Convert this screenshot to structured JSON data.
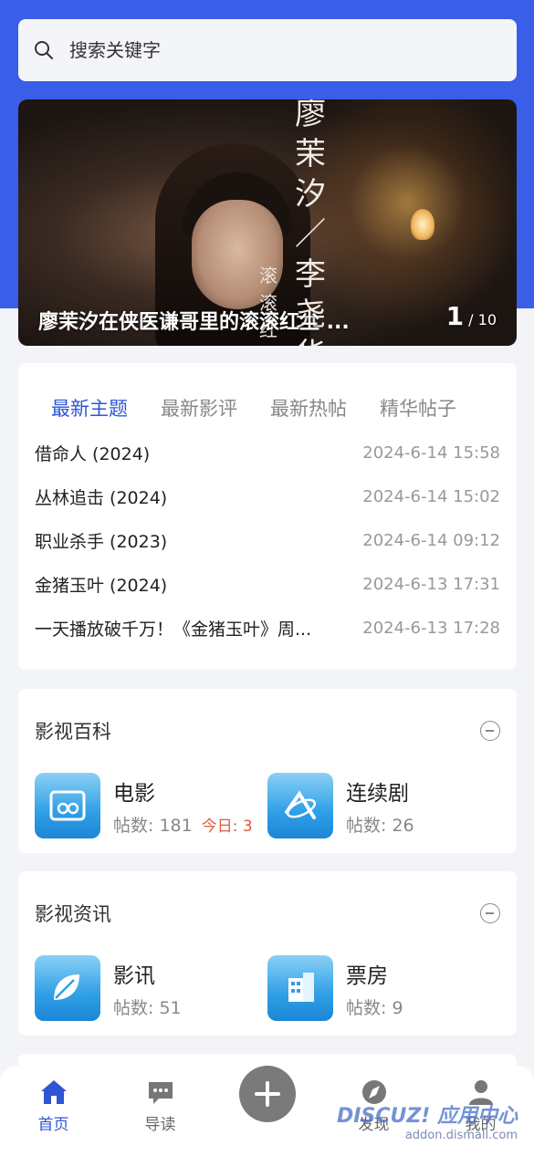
{
  "search": {
    "placeholder": "搜索关键字"
  },
  "banner": {
    "caption": "廖茉汐在侠医谦哥里的滚滚红尘 ...",
    "overlay_text": "廖茉汐／李尧华",
    "overlay_text2": "滚滚红尘",
    "current": "1",
    "total": "/ 10"
  },
  "latest": {
    "tabs": [
      "最新主题",
      "最新影评",
      "最新热帖",
      "精华帖子"
    ],
    "active_tab": 0,
    "rows": [
      {
        "title": "借命人 (2024)",
        "time": "2024-6-14 15:58"
      },
      {
        "title": "丛林追击 (2024)",
        "time": "2024-6-14 15:02"
      },
      {
        "title": "职业杀手 (2023)",
        "time": "2024-6-14 09:12"
      },
      {
        "title": "金猪玉叶 (2024)",
        "time": "2024-6-13 17:31"
      },
      {
        "title": "一天播放破千万！《金猪玉叶》周...",
        "time": "2024-6-13 17:28"
      }
    ]
  },
  "sections": [
    {
      "title": "影视百科",
      "forums": [
        {
          "name": "电影",
          "posts_label": "帖数: 181",
          "today_label": "今日: 3",
          "icon": "film-icon"
        },
        {
          "name": "连续剧",
          "posts_label": "帖数: 26",
          "icon": "satellite-icon"
        }
      ]
    },
    {
      "title": "影视资讯",
      "forums": [
        {
          "name": "影讯",
          "posts_label": "帖数: 51",
          "icon": "leaf-icon"
        },
        {
          "name": "票房",
          "posts_label": "帖数: 9",
          "icon": "building-icon"
        }
      ]
    }
  ],
  "tabbar": [
    {
      "label": "首页",
      "icon": "home-icon",
      "active": true
    },
    {
      "label": "导读",
      "icon": "chat-icon"
    },
    {
      "label": "",
      "icon": "plus-icon"
    },
    {
      "label": "发现",
      "icon": "discover-icon"
    },
    {
      "label": "我的",
      "icon": "user-icon"
    }
  ],
  "watermark": {
    "brand": "DISCUZ! 应用中心",
    "url": "addon.dismall.com"
  },
  "colors": {
    "accent": "#2f55d4",
    "header": "#3a5ee8",
    "today": "#e05a3a"
  }
}
